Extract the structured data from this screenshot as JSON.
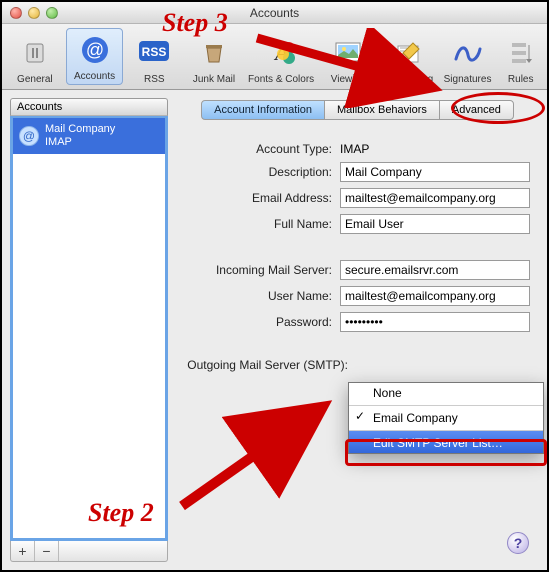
{
  "window": {
    "title": "Accounts"
  },
  "toolbar": {
    "items": [
      {
        "label": "General"
      },
      {
        "label": "Accounts"
      },
      {
        "label": "RSS"
      },
      {
        "label": "Junk Mail"
      },
      {
        "label": "Fonts & Colors"
      },
      {
        "label": "Viewing"
      },
      {
        "label": "Composing"
      },
      {
        "label": "Signatures"
      },
      {
        "label": "Rules"
      }
    ]
  },
  "sidebar": {
    "header": "Accounts",
    "items": [
      {
        "name": "Mail Company",
        "sub": "IMAP"
      }
    ],
    "add": "+",
    "remove": "−"
  },
  "tabs": {
    "info": "Account Information",
    "mailbox": "Mailbox Behaviors",
    "advanced": "Advanced"
  },
  "form": {
    "account_type_label": "Account Type:",
    "account_type_value": "IMAP",
    "description_label": "Description:",
    "description_value": "Mail Company",
    "email_label": "Email Address:",
    "email_value": "mailtest@emailcompany.org",
    "fullname_label": "Full Name:",
    "fullname_value": "Email User",
    "incoming_label": "Incoming Mail Server:",
    "incoming_value": "secure.emailsrvr.com",
    "username_label": "User Name:",
    "username_value": "mailtest@emailcompany.org",
    "password_label": "Password:",
    "password_value": "•••••••••",
    "smtp_label": "Outgoing Mail Server (SMTP):"
  },
  "smtp_menu": {
    "none": "None",
    "selected": "Email Company",
    "edit": "Edit SMTP Server List…"
  },
  "annotations": {
    "step3": "Step 3",
    "step2": "Step 2"
  },
  "help": "?"
}
